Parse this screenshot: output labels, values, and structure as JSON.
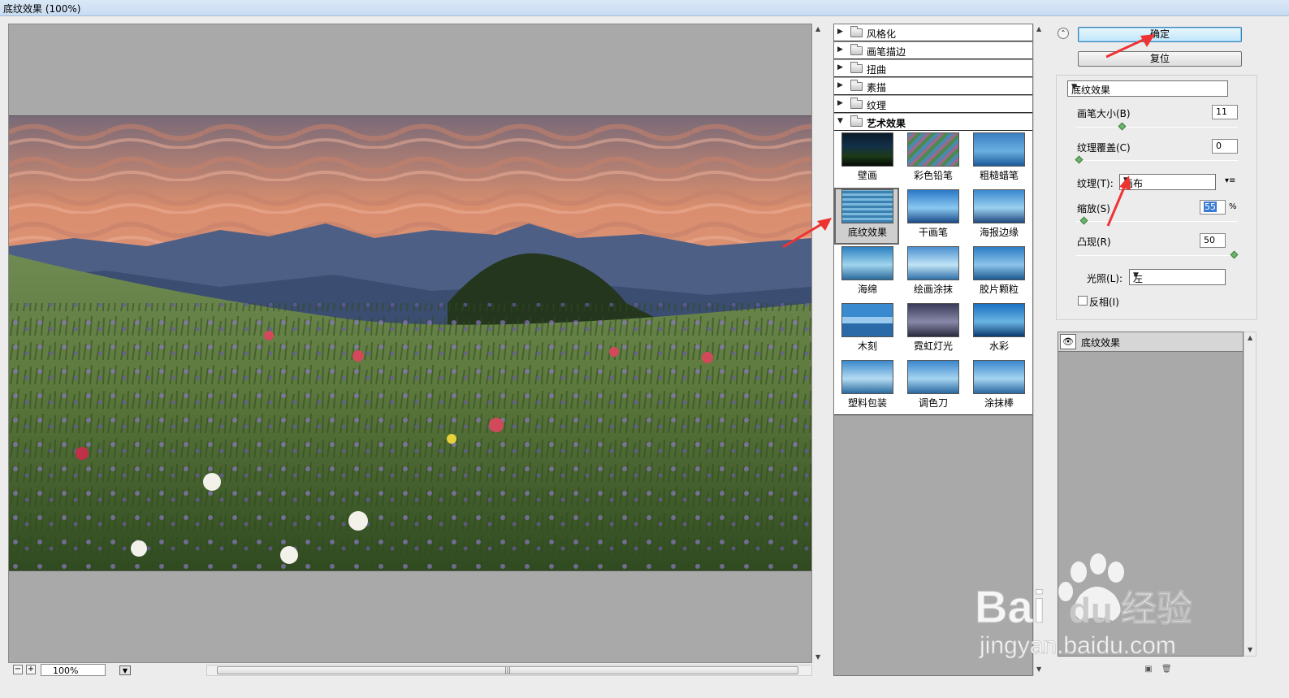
{
  "window": {
    "title": "底纹效果 (100%)"
  },
  "preview": {
    "zoom": "100%"
  },
  "filter_tree": {
    "folders": [
      {
        "label": "风格化",
        "expanded": false
      },
      {
        "label": "画笔描边",
        "expanded": false
      },
      {
        "label": "扭曲",
        "expanded": false
      },
      {
        "label": "素描",
        "expanded": false
      },
      {
        "label": "纹理",
        "expanded": false
      },
      {
        "label": "艺术效果",
        "expanded": true
      }
    ],
    "thumbnails": [
      {
        "label": "壁画"
      },
      {
        "label": "彩色铅笔"
      },
      {
        "label": "粗糙蜡笔"
      },
      {
        "label": "底纹效果",
        "selected": true
      },
      {
        "label": "干画笔"
      },
      {
        "label": "海报边缘"
      },
      {
        "label": "海绵"
      },
      {
        "label": "绘画涂抹"
      },
      {
        "label": "胶片颗粒"
      },
      {
        "label": "木刻"
      },
      {
        "label": "霓虹灯光"
      },
      {
        "label": "水彩"
      },
      {
        "label": "塑料包装"
      },
      {
        "label": "调色刀"
      },
      {
        "label": "涂抹棒"
      }
    ]
  },
  "buttons": {
    "ok": "确定",
    "reset": "复位"
  },
  "settings": {
    "filter_select": "底纹效果",
    "brush_size": {
      "label": "画笔大小(B)",
      "value": "11",
      "level": 0.28
    },
    "texture_coverage": {
      "label": "纹理覆盖(C)",
      "value": "0",
      "level": 0.0
    },
    "texture": {
      "label": "纹理(T):",
      "value": "画布"
    },
    "scaling": {
      "label": "缩放(S)",
      "value": "55",
      "unit": "%",
      "level": 0.03
    },
    "relief": {
      "label": "凸现(R)",
      "value": "50",
      "level": 1.0
    },
    "light": {
      "label": "光照(L):",
      "value": "左"
    },
    "invert": {
      "label": "反相(I)",
      "checked": false
    }
  },
  "effect_layers": [
    {
      "label": "底纹效果",
      "visible": true
    }
  ],
  "watermark": {
    "text1": "Bai",
    "text2": "du",
    "text3": "经验",
    "url": "jingyan.baidu.com"
  },
  "colors": {
    "accent_button": "#bfe6fb",
    "panel_gray": "#a9a9a9",
    "annotation_arrow": "#ee3333"
  }
}
